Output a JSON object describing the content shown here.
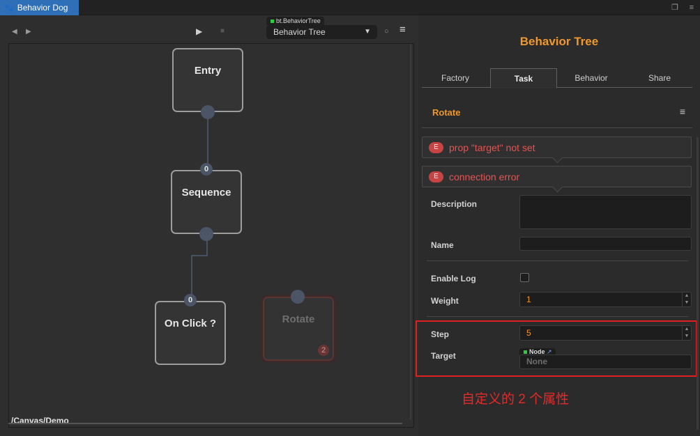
{
  "window": {
    "title": "Behavior Dog",
    "icons": {
      "app": "paw-icon",
      "restore": "restore-window-icon",
      "menu": "window-menu-icon"
    }
  },
  "toolbar": {
    "back": "◀",
    "forward": "▶",
    "play": "▶",
    "stop": "■",
    "tree_type_tag": "bt.BehaviorTree",
    "tree_select_value": "Behavior Tree",
    "status_dot": "○",
    "menu": "≡"
  },
  "canvas": {
    "nodes": {
      "entry": "Entry",
      "sequence": "Sequence",
      "on_click": "On Click ?",
      "rotate": "Rotate"
    },
    "port_indices": {
      "sequence_in": "0",
      "on_click_in": "0"
    },
    "rotate_badge": "2",
    "path": "/Canvas/Demo"
  },
  "inspector": {
    "title": "Behavior Tree",
    "tabs": [
      "Factory",
      "Task",
      "Behavior",
      "Share"
    ],
    "active_tab": "Task",
    "section_title": "Rotate",
    "section_menu": "≡",
    "errors": [
      {
        "icon": "E",
        "text": "prop \"target\" not set"
      },
      {
        "icon": "E",
        "text": "connection error"
      }
    ],
    "props": {
      "description_label": "Description",
      "description_value": "",
      "name_label": "Name",
      "name_value": "",
      "enable_log_label": "Enable Log",
      "enable_log_checked": false,
      "weight_label": "Weight",
      "weight_value": "1",
      "step_label": "Step",
      "step_value": "5",
      "target_label": "Target",
      "target_type_tag": "Node",
      "target_link": "↗",
      "target_value": "None"
    },
    "spinner": {
      "up": "▲",
      "down": "▼"
    },
    "annotation": "自定义的 2 个属性"
  },
  "colors": {
    "accent": "#f0982e",
    "error": "#e55353",
    "annotation": "#e52a2a",
    "title_tab": "#2f6fb8"
  }
}
